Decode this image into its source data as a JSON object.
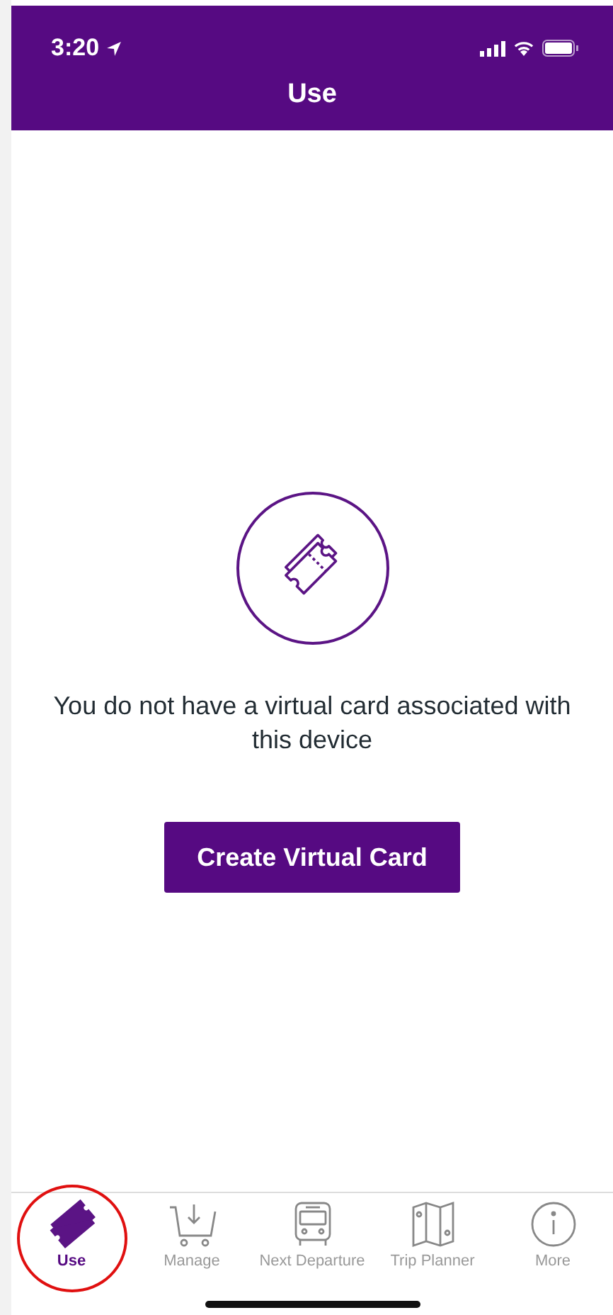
{
  "status_bar": {
    "time": "3:20"
  },
  "header": {
    "title": "Use"
  },
  "empty_state": {
    "message": "You do not have a virtual card associated with this device",
    "button": "Create Virtual Card"
  },
  "tab_bar": [
    {
      "label": "Use",
      "kind": "ticket",
      "selected": true
    },
    {
      "label": "Manage",
      "kind": "cart",
      "selected": false
    },
    {
      "label": "Next Departure",
      "kind": "bus",
      "selected": false
    },
    {
      "label": "Trip Planner",
      "kind": "map",
      "selected": false
    },
    {
      "label": "More",
      "kind": "info",
      "selected": false
    }
  ]
}
